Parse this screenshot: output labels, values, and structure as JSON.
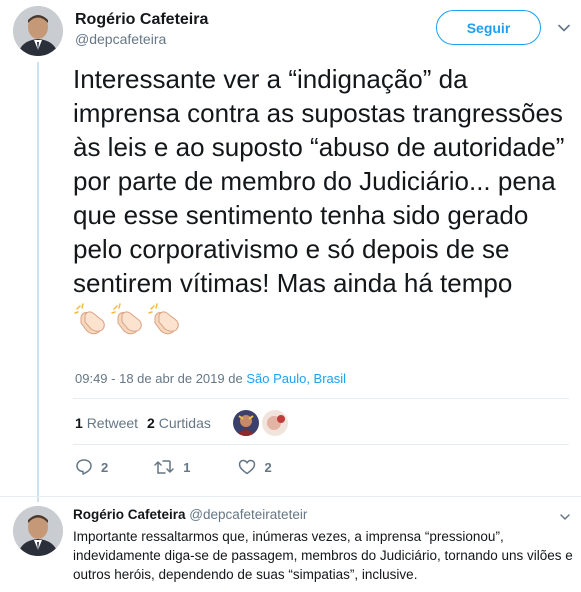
{
  "tweet": {
    "author_name": "Rogério Cafeteira",
    "author_handle": "@depcafeteira",
    "follow_label": "Seguir",
    "text": "Interessante ver a “indignação” da imprensa contra as supostas trangressões às leis e ao suposto “abuso de autoridade” por parte de membro do Judiciário... pena que esse sentimento tenha sido gerado pelo corporativismo e só depois de se sentirem vítimas! Mas ainda há tempo",
    "emoji": [
      "clapping-hands-icon",
      "clapping-hands-icon",
      "clapping-hands-icon"
    ],
    "timestamp": "09:49 - 18 de abr de 2019 de",
    "location": "São Paulo, Brasil",
    "retweets_count": "1",
    "retweets_label": "Retweet",
    "likes_count": "2",
    "likes_label": "Curtidas",
    "actions": {
      "replies": "2",
      "retweets": "1",
      "likes": "2"
    }
  },
  "reply": {
    "author_name": "Rogério Cafeteira",
    "author_handle": "@depcafeteirateteir",
    "text": "Importante ressaltarmos que, inúmeras vezes, a imprensa “pressionou”, indevidamente diga-se de passagem, membros do Judiciário, tornando uns vilões e outros heróis, dependendo de suas “simpatias”, inclusive."
  },
  "colors": {
    "accent": "#1da1f2",
    "text": "#14171a",
    "muted": "#657786",
    "thread_line": "#cce1f2"
  }
}
